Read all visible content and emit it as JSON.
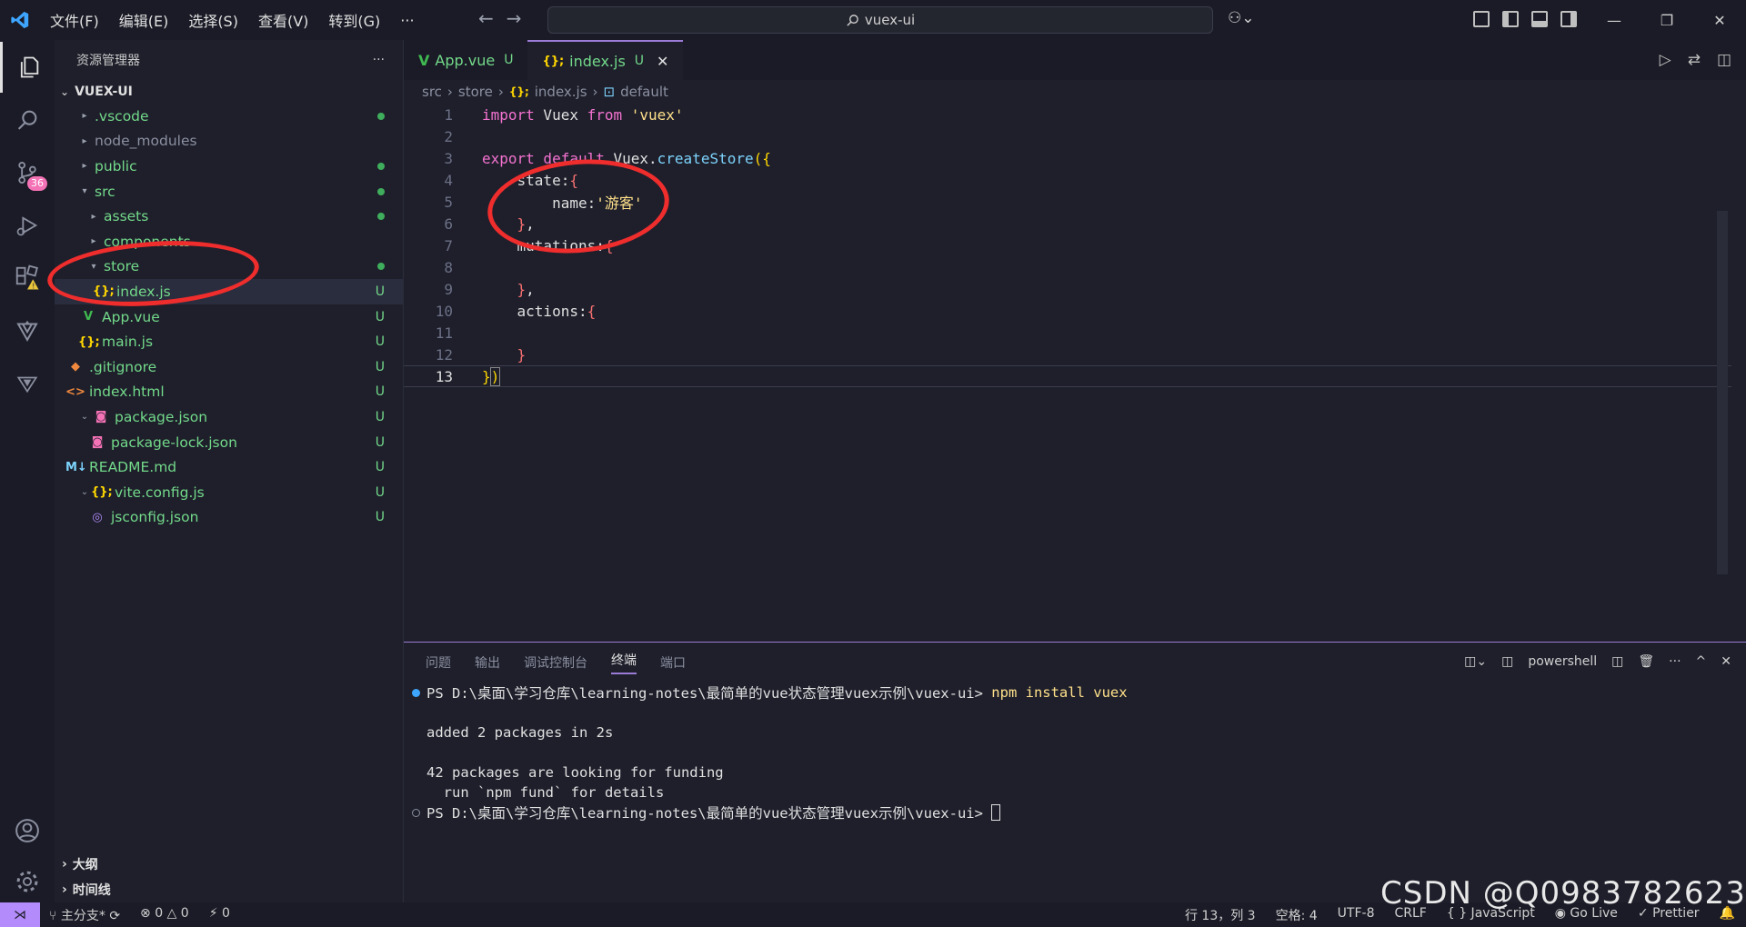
{
  "titlebar": {
    "menu": [
      "文件(F)",
      "编辑(E)",
      "选择(S)",
      "查看(V)",
      "转到(G)",
      "···"
    ],
    "search": "vuex-ui",
    "back": "←",
    "forward": "→",
    "copilot": "⚇⌄",
    "win_min": "—",
    "win_max": "❐",
    "win_close": "✕"
  },
  "activity": {
    "scm_badge": "36",
    "accent": "#b38bfa"
  },
  "explorer": {
    "title": "资源管理器",
    "more": "···",
    "project": "VUEX-UI",
    "items": [
      {
        "label": ".vscode",
        "twisty": "▸",
        "icon": "",
        "status": "dot"
      },
      {
        "label": "node_modules",
        "twisty": "▸",
        "icon": "",
        "status": ""
      },
      {
        "label": "public",
        "twisty": "▸",
        "icon": "",
        "status": "dot"
      },
      {
        "label": "src",
        "twisty": "▾",
        "icon": "",
        "status": "dot"
      },
      {
        "label": "assets",
        "twisty": "▸",
        "icon": "",
        "status": "dot"
      },
      {
        "label": "components",
        "twisty": "▸",
        "icon": "",
        "status": ""
      },
      {
        "label": "store",
        "twisty": "▾",
        "icon": "",
        "status": "dot"
      },
      {
        "label": "index.js",
        "twisty": "",
        "icon": "{};",
        "status": "U"
      },
      {
        "label": "App.vue",
        "twisty": "",
        "icon": "V",
        "status": "U"
      },
      {
        "label": "main.js",
        "twisty": "",
        "icon": "{};",
        "status": "U"
      },
      {
        "label": ".gitignore",
        "twisty": "",
        "icon": "◆",
        "status": "U"
      },
      {
        "label": "index.html",
        "twisty": "",
        "icon": "<>",
        "status": "U"
      },
      {
        "label": "package.json",
        "twisty": "⌄",
        "icon": "◙",
        "status": "U"
      },
      {
        "label": "package-lock.json",
        "twisty": "",
        "icon": "◙",
        "status": "U"
      },
      {
        "label": "README.md",
        "twisty": "",
        "icon": "M↓",
        "status": "U"
      },
      {
        "label": "vite.config.js",
        "twisty": "⌄",
        "icon": "{};",
        "status": "U"
      },
      {
        "label": "jsconfig.json",
        "twisty": "",
        "icon": "◎",
        "status": "U"
      }
    ],
    "outline": "大纲",
    "timeline": "时间线"
  },
  "tabs": [
    {
      "label": "App.vue",
      "icon": "V",
      "badge": "U"
    },
    {
      "label": "index.js",
      "icon": "{};",
      "badge": "U",
      "close": "✕"
    }
  ],
  "breadcrumb": {
    "parts": [
      "src",
      "store",
      "index.js",
      "default"
    ],
    "sep": "›",
    "icon_js": "{};",
    "icon_sym": "⊡"
  },
  "code": {
    "line_numbers": [
      "1",
      "2",
      "3",
      "4",
      "5",
      "6",
      "7",
      "8",
      "9",
      "10",
      "11",
      "12",
      "13"
    ],
    "kw_import": "import",
    "ident_vuex": " Vuex ",
    "kw_from": "from",
    "str_vuex": " 'vuex'",
    "kw_export": "export",
    "kw_default": " default",
    "ident_createstore": " Vuex.",
    "fn_create": "createStore",
    "paren_open": "(",
    "brace_open": "{",
    "state": "    state:",
    "brace_red_open": "{",
    "name": "        name:",
    "str_guest": "'游客'",
    "brace_red_close": "    }",
    "comma": ",",
    "mutations": "    mutations:",
    "actions": "    actions:",
    "brace_close": "}",
    "paren_close": ")"
  },
  "panel": {
    "tabs": [
      "问题",
      "输出",
      "调试控制台",
      "终端",
      "端口"
    ],
    "shell": "powershell",
    "split": "◫⌄",
    "shell_icon": "◫",
    "split2": "◫",
    "trash": "🗑",
    "more": "···",
    "up": "^",
    "close": "✕",
    "terminal": {
      "prompt1": "PS D:\\桌面\\学习仓库\\learning-notes\\最简单的vue状态管理vuex示例\\vuex-ui> ",
      "cmd1": "npm install vuex",
      "line_added": "added 2 packages in 2s",
      "line_funding": "42 packages are looking for funding",
      "line_fund": "  run `npm fund` for details",
      "prompt2": "PS D:\\桌面\\学习仓库\\learning-notes\\最简单的vue状态管理vuex示例\\vuex-ui> "
    }
  },
  "statusbar": {
    "branch": "主分支*",
    "sync": "⟳",
    "errors": "⊗ 0 △ 0",
    "ports": "⚡ 0",
    "position": "行 13，列 3",
    "spaces": "空格: 4",
    "encoding": "UTF-8",
    "eol": "CRLF",
    "language": "{ } JavaScript",
    "golive": "Go Live",
    "prettier": "Prettier"
  },
  "watermark": "CSDN @Q0983782623"
}
